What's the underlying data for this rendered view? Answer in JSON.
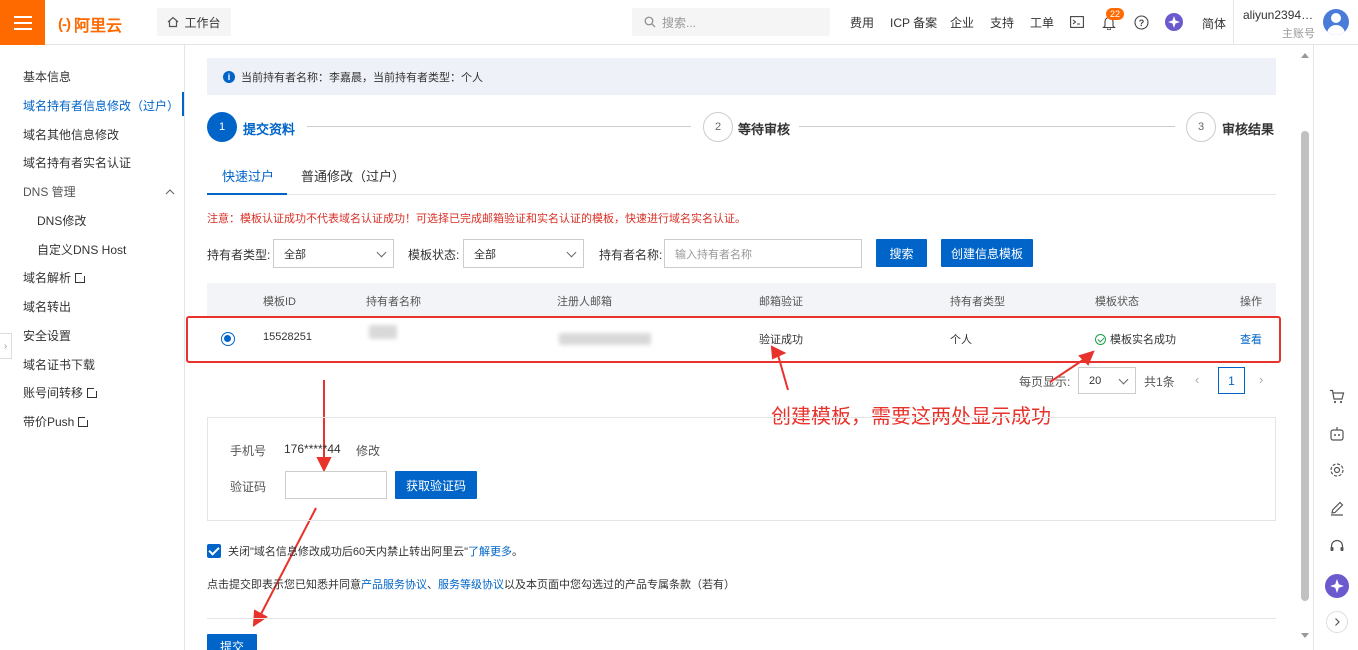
{
  "header": {
    "logo_text": "阿里云",
    "logo_mark": "(-)",
    "workbench": "工作台",
    "search_placeholder": "搜索...",
    "nav": [
      "费用",
      "ICP 备案",
      "企业",
      "支持",
      "工单"
    ],
    "notification_count": "22",
    "language": "简体",
    "account_name": "aliyun23947...",
    "account_role": "主账号"
  },
  "sidebar": {
    "items": [
      {
        "label": "基本信息"
      },
      {
        "label": "域名持有者信息修改（过户）"
      },
      {
        "label": "域名其他信息修改"
      },
      {
        "label": "域名持有者实名认证"
      },
      {
        "label": "DNS 管理"
      },
      {
        "label": "DNS修改"
      },
      {
        "label": "自定义DNS Host"
      },
      {
        "label": "域名解析"
      },
      {
        "label": "域名转出"
      },
      {
        "label": "安全设置"
      },
      {
        "label": "域名证书下载"
      },
      {
        "label": "账号间转移"
      },
      {
        "label": "带价Push"
      }
    ]
  },
  "notice": "当前持有者名称：李嘉晨，当前持有者类型：个人",
  "steps": [
    {
      "num": "1",
      "label": "提交资料"
    },
    {
      "num": "2",
      "label": "等待审核"
    },
    {
      "num": "3",
      "label": "审核结果"
    }
  ],
  "tabs": [
    "快速过户",
    "普通修改（过户）"
  ],
  "warning": "注意：模板认证成功不代表域名认证成功！可选择已完成邮箱验证和实名认证的模板，快速进行域名实名认证。",
  "filters": {
    "holder_type_label": "持有者类型:",
    "holder_type_value": "全部",
    "template_status_label": "模板状态:",
    "template_status_value": "全部",
    "holder_name_label": "持有者名称:",
    "holder_name_placeholder": "输入持有者名称",
    "search_button": "搜索",
    "create_button": "创建信息模板"
  },
  "table": {
    "headers": [
      "模板ID",
      "持有者名称",
      "注册人邮箱",
      "邮箱验证",
      "持有者类型",
      "模板状态",
      "操作"
    ],
    "rows": [
      {
        "id": "15528251",
        "holder_name": "",
        "email": "",
        "email_verify": "验证成功",
        "holder_type": "个人",
        "status": "模板实名成功",
        "action": "查看"
      }
    ]
  },
  "pagination": {
    "per_page_label": "每页显示:",
    "per_page_value": "20",
    "total": "共1条",
    "current_page": "1"
  },
  "annotation": "创建模板，需要这两处显示成功",
  "verify": {
    "phone_label": "手机号",
    "phone_value": "176*****44",
    "modify_link": "修改",
    "code_label": "验证码",
    "get_code_button": "获取验证码"
  },
  "agreement": {
    "text": "关闭\"域名信息修改成功后60天内禁止转出阿里云\"",
    "link": "了解更多",
    "dot": "。"
  },
  "terms": {
    "prefix": "点击提交即表示您已知悉并同意",
    "link1": "产品服务协议",
    "sep": "、",
    "link2": "服务等级协议",
    "suffix": "以及本页面中您勾选过的产品专属条款（若有）"
  },
  "submit_button": "提交",
  "colors": {
    "brand": "#ff6a00",
    "primary": "#0064c8",
    "annotation_red": "#e8322c",
    "success": "#1e9e4a"
  }
}
